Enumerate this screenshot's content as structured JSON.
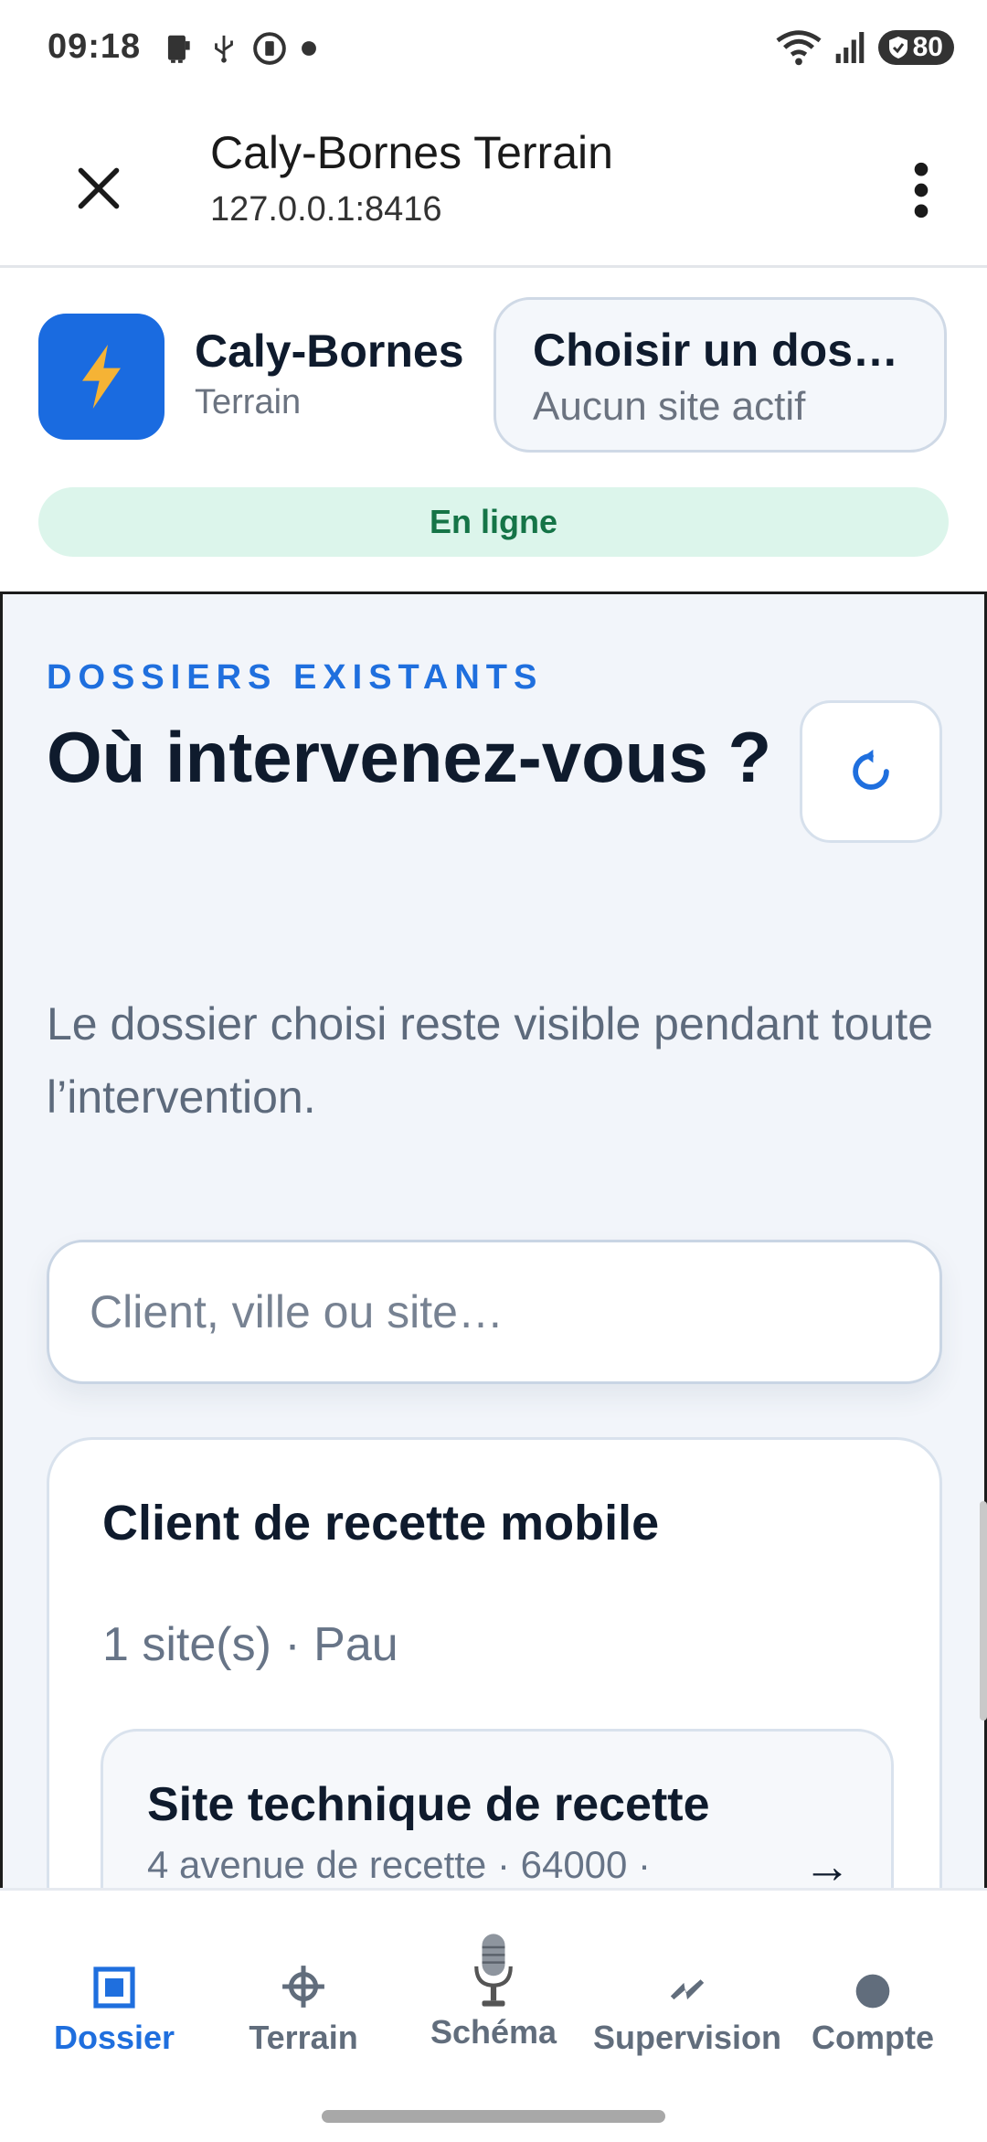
{
  "status_bar": {
    "time": "09:18",
    "battery": "80"
  },
  "browser": {
    "title": "Caly-Bornes Terrain",
    "url": "127.0.0.1:8416"
  },
  "app": {
    "name": "Caly-Bornes",
    "subtitle": "Terrain",
    "folder_button": {
      "title": "Choisir un dos…",
      "subtitle": "Aucun site actif"
    },
    "connection_status": "En ligne"
  },
  "main": {
    "eyebrow": "DOSSIERS EXISTANTS",
    "title": "Où intervenez-vous ?",
    "help": "Le dossier choisi reste visible pendant toute l’intervention.",
    "search": {
      "placeholder": "Client, ville ou site…",
      "value": ""
    },
    "clients": [
      {
        "name": "Client de recette mobile",
        "meta": "1 site(s) · Pau",
        "sites": [
          {
            "name": "Site technique de recette",
            "address": "4 avenue de recette · 64000 ·",
            "arrow": "→"
          }
        ]
      }
    ]
  },
  "bottom_nav": [
    {
      "label": "Dossier",
      "icon": "square-target-icon",
      "active": true
    },
    {
      "label": "Terrain",
      "icon": "crosshair-icon",
      "active": false
    },
    {
      "label": "Schéma",
      "icon": "microphone-icon",
      "active": false
    },
    {
      "label": "Supervision",
      "icon": "lightning-icon",
      "active": false
    },
    {
      "label": "Compte",
      "icon": "circle-icon",
      "active": false
    }
  ],
  "colors": {
    "accent": "#1f6fde",
    "online_bg": "#dcf5eb",
    "online_text": "#157447",
    "logo_bg": "#1a6be0"
  }
}
